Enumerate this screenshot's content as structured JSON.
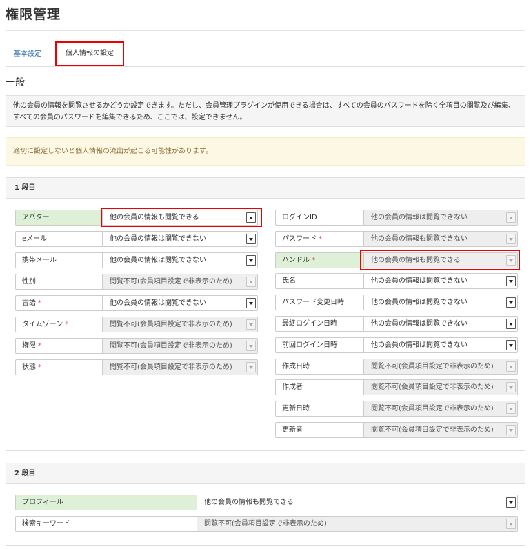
{
  "page": {
    "title": "権限管理",
    "tabs": [
      {
        "label": "基本設定",
        "active": false
      },
      {
        "label": "個人情報の設定",
        "active": true
      }
    ],
    "section_heading": "一般",
    "info_text": "他の会員の情報を閲覧させるかどうか設定できます。ただし、会員管理プラグインが使用できる場合は、すべての会員のパスワードを除く全項目の閲覧及び編集、すべての会員のパスワードを編集できるため、ここでは、設定できません。",
    "warning_text": "適切に設定しないと個人情報の流出が起こる可能性があります。"
  },
  "panel1": {
    "title": "1 段目",
    "left": [
      {
        "label": "アバター",
        "required": "",
        "value": "他の会員の情報も閲覧できる",
        "disabled": false,
        "green": true
      },
      {
        "label": "eメール",
        "required": "",
        "value": "他の会員の情報は閲覧できない",
        "disabled": false,
        "green": false
      },
      {
        "label": "携帯メール",
        "required": "",
        "value": "他の会員の情報は閲覧できない",
        "disabled": false,
        "green": false
      },
      {
        "label": "性別",
        "required": "",
        "value": "閲覧不可(会員項目設定で非表示のため)",
        "disabled": true,
        "green": false
      },
      {
        "label": "言語",
        "required": "*",
        "value": "他の会員の情報は閲覧できない",
        "disabled": false,
        "green": false
      },
      {
        "label": "タイムゾーン",
        "required": "*",
        "value": "閲覧不可(会員項目設定で非表示のため)",
        "disabled": true,
        "green": false
      },
      {
        "label": "権限",
        "required": "*",
        "value": "閲覧不可(会員項目設定で非表示のため)",
        "disabled": true,
        "green": false
      },
      {
        "label": "状態",
        "required": "*",
        "value": "閲覧不可(会員項目設定で非表示のため)",
        "disabled": true,
        "green": false
      }
    ],
    "right": [
      {
        "label": "ログインID",
        "required": "",
        "value": "他の会員の情報は閲覧できない",
        "disabled": true,
        "green": false
      },
      {
        "label": "パスワード",
        "required": "*",
        "value": "他の会員の情報も閲覧できない",
        "disabled": true,
        "green": false
      },
      {
        "label": "ハンドル",
        "required": "*",
        "value": "他の会員の情報も閲覧できる",
        "disabled": true,
        "green": true
      },
      {
        "label": "氏名",
        "required": "",
        "value": "他の会員の情報は閲覧できない",
        "disabled": false,
        "green": false
      },
      {
        "label": "パスワード変更日時",
        "required": "",
        "value": "他の会員の情報は閲覧できない",
        "disabled": false,
        "green": false
      },
      {
        "label": "最終ログイン日時",
        "required": "",
        "value": "他の会員の情報は閲覧できない",
        "disabled": false,
        "green": false
      },
      {
        "label": "前回ログイン日時",
        "required": "",
        "value": "他の会員の情報は閲覧できない",
        "disabled": false,
        "green": false
      },
      {
        "label": "作成日時",
        "required": "",
        "value": "閲覧不可(会員項目設定で非表示のため)",
        "disabled": true,
        "green": false
      },
      {
        "label": "作成者",
        "required": "",
        "value": "閲覧不可(会員項目設定で非表示のため)",
        "disabled": true,
        "green": false
      },
      {
        "label": "更新日時",
        "required": "",
        "value": "閲覧不可(会員項目設定で非表示のため)",
        "disabled": true,
        "green": false
      },
      {
        "label": "更新者",
        "required": "",
        "value": "閲覧不可(会員項目設定で非表示のため)",
        "disabled": true,
        "green": false
      }
    ]
  },
  "panel2": {
    "title": "2 段目",
    "rows": [
      {
        "label": "プロフィール",
        "required": "",
        "value": "他の会員の情報も閲覧できる",
        "disabled": false,
        "green": true
      },
      {
        "label": "検索キーワード",
        "required": "",
        "value": "閲覧不可(会員項目設定で非表示のため)",
        "disabled": true,
        "green": false
      }
    ]
  },
  "colors": {
    "highlight": "#ee0000",
    "green_label": "#dff0d8",
    "warning_bg": "#fcf8e3",
    "link": "#2a6aa8"
  }
}
